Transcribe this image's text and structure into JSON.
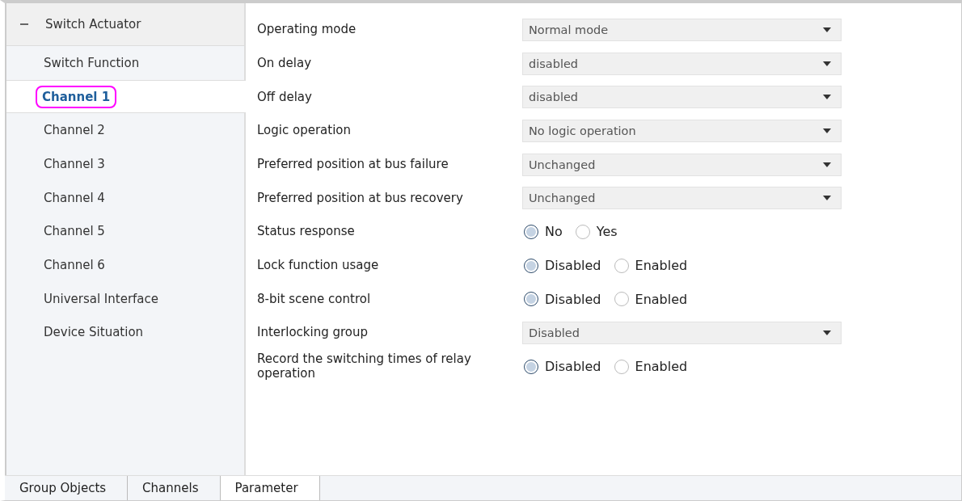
{
  "sidebar": {
    "header": {
      "label": "Switch Actuator",
      "expanded": true
    },
    "items": [
      {
        "label": "Switch Function",
        "selected": false
      },
      {
        "label": "Channel 1",
        "selected": true
      },
      {
        "label": "Channel 2",
        "selected": false
      },
      {
        "label": "Channel 3",
        "selected": false
      },
      {
        "label": "Channel 4",
        "selected": false
      },
      {
        "label": "Channel 5",
        "selected": false
      },
      {
        "label": "Channel 6",
        "selected": false
      },
      {
        "label": "Universal Interface",
        "selected": false
      },
      {
        "label": "Device Situation",
        "selected": false
      }
    ]
  },
  "parameters": [
    {
      "kind": "dropdown",
      "label": "Operating mode",
      "value": "Normal mode"
    },
    {
      "kind": "dropdown",
      "label": "On delay",
      "value": "disabled"
    },
    {
      "kind": "dropdown",
      "label": "Off delay",
      "value": "disabled"
    },
    {
      "kind": "dropdown",
      "label": "Logic operation",
      "value": "No logic operation"
    },
    {
      "kind": "dropdown",
      "label": "Preferred position at bus failure",
      "value": "Unchanged"
    },
    {
      "kind": "dropdown",
      "label": "Preferred position at bus recovery",
      "value": "Unchanged"
    },
    {
      "kind": "radio",
      "label": "Status response",
      "options": [
        {
          "label": "No",
          "selected": true
        },
        {
          "label": "Yes",
          "selected": false
        }
      ]
    },
    {
      "kind": "radio",
      "label": "Lock function usage",
      "options": [
        {
          "label": "Disabled",
          "selected": true
        },
        {
          "label": "Enabled",
          "selected": false
        }
      ]
    },
    {
      "kind": "radio",
      "label": "8-bit scene control",
      "options": [
        {
          "label": "Disabled",
          "selected": true
        },
        {
          "label": "Enabled",
          "selected": false
        }
      ]
    },
    {
      "kind": "dropdown",
      "label": "Interlocking group",
      "value": "Disabled"
    },
    {
      "kind": "radio",
      "label": "Record the switching times of relay operation",
      "options": [
        {
          "label": "Disabled",
          "selected": true
        },
        {
          "label": "Enabled",
          "selected": false
        }
      ]
    }
  ],
  "tabs": [
    {
      "label": "Group Objects",
      "selected": false
    },
    {
      "label": "Channels",
      "selected": false
    },
    {
      "label": "Parameter",
      "selected": true
    }
  ]
}
